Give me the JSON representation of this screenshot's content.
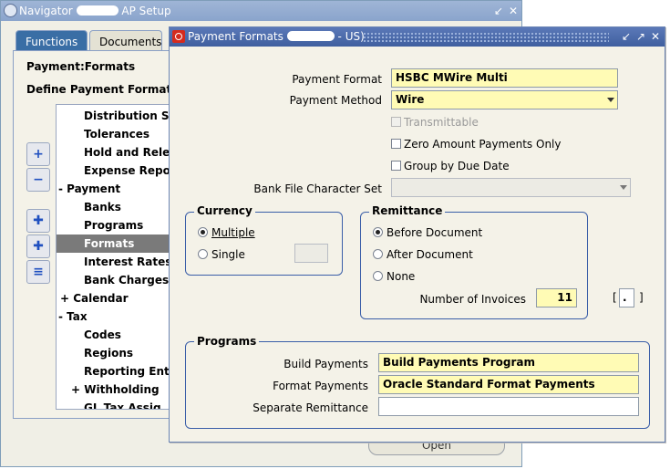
{
  "navigator": {
    "title_prefix": "Navigator",
    "title_suffix": "AP Setup",
    "tabs": [
      {
        "label": "Functions"
      },
      {
        "label": "Documents"
      }
    ],
    "heading1": "Payment:Formats",
    "heading2": "Define Payment Formats",
    "tree": [
      "Distribution Sets",
      "Tolerances",
      "Hold and Release",
      "Expense Reports",
      "-  Payment",
      "Banks",
      "Programs",
      "Formats",
      "Interest Rates",
      "Bank Charges",
      "+  Calendar",
      "-  Tax",
      "Codes",
      "Regions",
      "Reporting Entity",
      "+  Withholding",
      "GL Tax Assig..."
    ],
    "selected_index": 7,
    "open_label": "Open"
  },
  "payment_formats": {
    "title_prefix": "Payment Formats",
    "title_suffix": "- US)",
    "payment_format_label": "Payment Format",
    "payment_format_value": "HSBC MWire Multi",
    "payment_method_label": "Payment Method",
    "payment_method_value": "Wire",
    "checkboxes": {
      "transmittable": "Transmittable",
      "zero_amount": "Zero Amount Payments Only",
      "group_by_due": "Group by Due Date"
    },
    "bank_file_charset_label": "Bank File Character Set",
    "bank_file_charset_value": "",
    "currency": {
      "title": "Currency",
      "multiple": "Multiple",
      "single": "Single",
      "selected": "multiple",
      "single_value": ""
    },
    "remittance": {
      "title": "Remittance",
      "before": "Before Document",
      "after": "After Document",
      "none": "None",
      "selected": "before",
      "num_invoices_label": "Number of Invoices",
      "num_invoices_value": "11"
    },
    "bracket_value": ".",
    "programs": {
      "title": "Programs",
      "build_label": "Build Payments",
      "build_value": "Build Payments Program",
      "format_label": "Format Payments",
      "format_value": "Oracle Standard Format Payments",
      "separate_label": "Separate Remittance",
      "separate_value": ""
    }
  }
}
